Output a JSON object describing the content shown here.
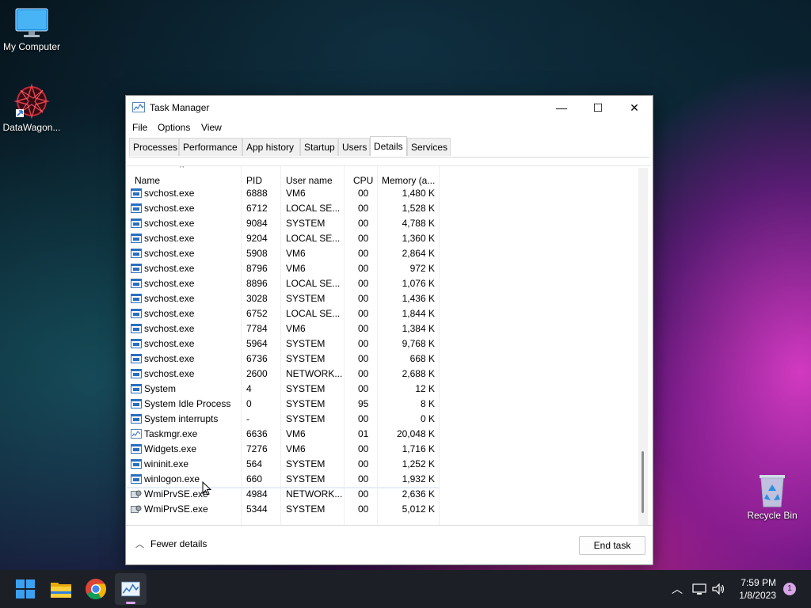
{
  "desktop": {
    "icons": [
      {
        "label": "My Computer"
      },
      {
        "label": "DataWagon..."
      },
      {
        "label": "Recycle Bin"
      }
    ]
  },
  "window": {
    "title": "Task Manager",
    "controls": {
      "minimize": "—",
      "maximize": "☐",
      "close": "✕"
    },
    "menu": [
      "File",
      "Options",
      "View"
    ],
    "tabs": [
      "Processes",
      "Performance",
      "App history",
      "Startup",
      "Users",
      "Details",
      "Services"
    ],
    "active_tab": "Details",
    "columns": [
      "Name",
      "PID",
      "User name",
      "CPU",
      "Memory (a..."
    ],
    "sort_indicator": "^",
    "rows": [
      {
        "name": "svchost.exe",
        "pid": "6888",
        "user": "VM6",
        "cpu": "00",
        "mem": "1,480 K",
        "icon": "service-icon"
      },
      {
        "name": "svchost.exe",
        "pid": "6712",
        "user": "LOCAL SE...",
        "cpu": "00",
        "mem": "1,528 K",
        "icon": "service-icon"
      },
      {
        "name": "svchost.exe",
        "pid": "9084",
        "user": "SYSTEM",
        "cpu": "00",
        "mem": "4,788 K",
        "icon": "service-icon"
      },
      {
        "name": "svchost.exe",
        "pid": "9204",
        "user": "LOCAL SE...",
        "cpu": "00",
        "mem": "1,360 K",
        "icon": "service-icon"
      },
      {
        "name": "svchost.exe",
        "pid": "5908",
        "user": "VM6",
        "cpu": "00",
        "mem": "2,864 K",
        "icon": "service-icon"
      },
      {
        "name": "svchost.exe",
        "pid": "8796",
        "user": "VM6",
        "cpu": "00",
        "mem": "972 K",
        "icon": "service-icon"
      },
      {
        "name": "svchost.exe",
        "pid": "8896",
        "user": "LOCAL SE...",
        "cpu": "00",
        "mem": "1,076 K",
        "icon": "service-icon"
      },
      {
        "name": "svchost.exe",
        "pid": "3028",
        "user": "SYSTEM",
        "cpu": "00",
        "mem": "1,436 K",
        "icon": "service-icon"
      },
      {
        "name": "svchost.exe",
        "pid": "6752",
        "user": "LOCAL SE...",
        "cpu": "00",
        "mem": "1,844 K",
        "icon": "service-icon"
      },
      {
        "name": "svchost.exe",
        "pid": "7784",
        "user": "VM6",
        "cpu": "00",
        "mem": "1,384 K",
        "icon": "service-icon"
      },
      {
        "name": "svchost.exe",
        "pid": "5964",
        "user": "SYSTEM",
        "cpu": "00",
        "mem": "9,768 K",
        "icon": "service-icon"
      },
      {
        "name": "svchost.exe",
        "pid": "6736",
        "user": "SYSTEM",
        "cpu": "00",
        "mem": "668 K",
        "icon": "service-icon"
      },
      {
        "name": "svchost.exe",
        "pid": "2600",
        "user": "NETWORK...",
        "cpu": "00",
        "mem": "2,688 K",
        "icon": "service-icon"
      },
      {
        "name": "System",
        "pid": "4",
        "user": "SYSTEM",
        "cpu": "00",
        "mem": "12 K",
        "icon": "service-icon"
      },
      {
        "name": "System Idle Process",
        "pid": "0",
        "user": "SYSTEM",
        "cpu": "95",
        "mem": "8 K",
        "icon": "service-icon"
      },
      {
        "name": "System interrupts",
        "pid": "-",
        "user": "SYSTEM",
        "cpu": "00",
        "mem": "0 K",
        "icon": "service-icon"
      },
      {
        "name": "Taskmgr.exe",
        "pid": "6636",
        "user": "VM6",
        "cpu": "01",
        "mem": "20,048 K",
        "icon": "task-manager-icon"
      },
      {
        "name": "Widgets.exe",
        "pid": "7276",
        "user": "VM6",
        "cpu": "00",
        "mem": "1,716 K",
        "icon": "service-icon"
      },
      {
        "name": "wininit.exe",
        "pid": "564",
        "user": "SYSTEM",
        "cpu": "00",
        "mem": "1,252 K",
        "icon": "service-icon"
      },
      {
        "name": "winlogon.exe",
        "pid": "660",
        "user": "SYSTEM",
        "cpu": "00",
        "mem": "1,932 K",
        "icon": "service-icon"
      },
      {
        "name": "WmiPrvSE.exe",
        "pid": "4984",
        "user": "NETWORK...",
        "cpu": "00",
        "mem": "2,636 K",
        "icon": "wmi-icon"
      },
      {
        "name": "WmiPrvSE.exe",
        "pid": "5344",
        "user": "SYSTEM",
        "cpu": "00",
        "mem": "5,012 K",
        "icon": "wmi-icon"
      }
    ],
    "footer": {
      "fewer_details": "Fewer details",
      "end_task": "End task"
    }
  },
  "taskbar": {
    "items": [
      "start-icon",
      "file-explorer-icon",
      "chrome-icon",
      "task-manager-icon"
    ],
    "time": "7:59 PM",
    "date": "1/8/2023",
    "notification_count": "1"
  }
}
